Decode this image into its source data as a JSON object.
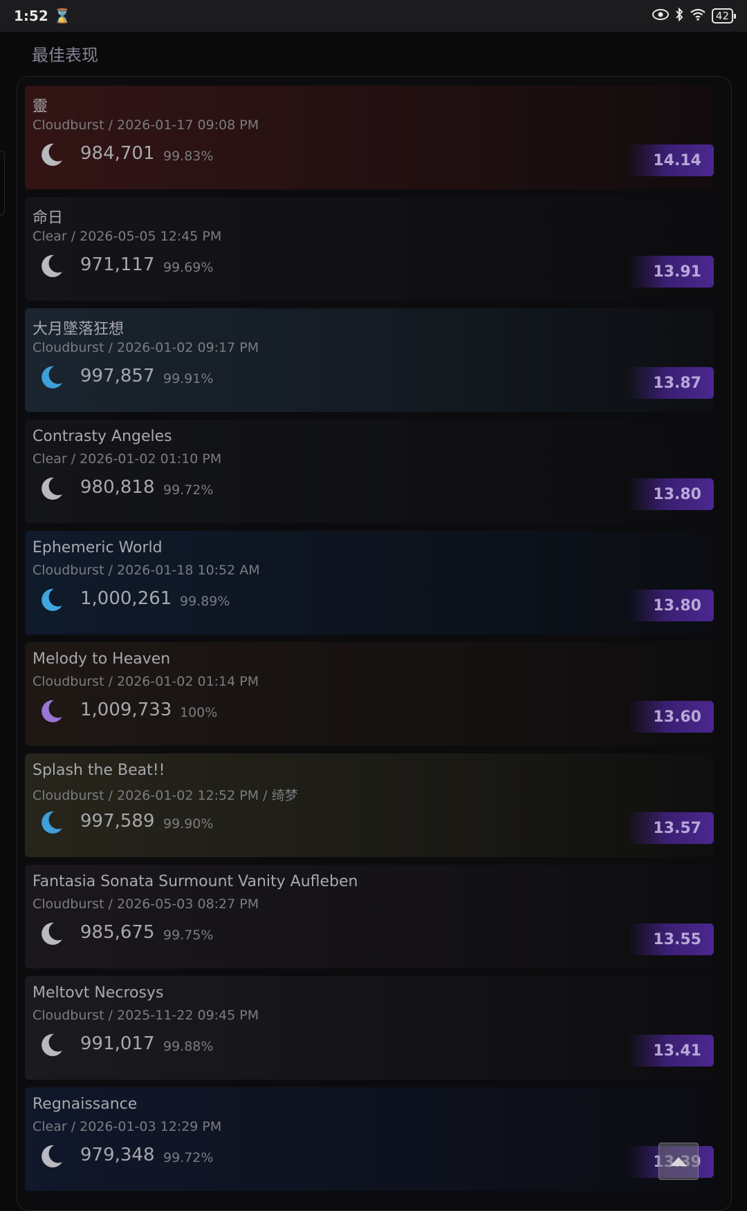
{
  "status_bar": {
    "time": "1:52",
    "battery": "42"
  },
  "section_title": "最佳表现",
  "records": [
    {
      "title": "靈",
      "meta": "Cloudburst / 2026-01-17 09:08 PM",
      "score": "984,701",
      "accuracy": "99.83%",
      "rating": "14.14",
      "moon_color": "#b9b9c0",
      "bg": "#3a1616"
    },
    {
      "title": "命日",
      "meta": "Clear / 2026-05-05 12:45 PM",
      "score": "971,117",
      "accuracy": "99.69%",
      "rating": "13.91",
      "moon_color": "#b9b9c0",
      "bg": "#17171b"
    },
    {
      "title": "大月墜落狂想",
      "meta": "Cloudburst / 2026-01-02 09:17 PM",
      "score": "997,857",
      "accuracy": "99.91%",
      "rating": "13.87",
      "moon_color": "#3f9fd8",
      "bg": "#1d2a36"
    },
    {
      "title": "Contrasty Angeles",
      "meta": "Clear / 2026-01-02 01:10 PM",
      "score": "980,818",
      "accuracy": "99.72%",
      "rating": "13.80",
      "moon_color": "#b9b9c0",
      "bg": "#16171b"
    },
    {
      "title": "Ephemeric World",
      "meta": "Cloudburst / 2026-01-18 10:52 AM",
      "score": "1,000,261",
      "accuracy": "99.89%",
      "rating": "13.80",
      "moon_color": "#3fa6e0",
      "bg": "#101d30"
    },
    {
      "title": "Melody to Heaven",
      "meta": "Cloudburst / 2026-01-02 01:14 PM",
      "score": "1,009,733",
      "accuracy": "100%",
      "rating": "13.60",
      "moon_color": "#9a74d6",
      "bg": "#221a16"
    },
    {
      "title": "Splash the Beat!!",
      "meta": "Cloudburst / 2026-01-02 12:52 PM / 绮梦",
      "score": "997,589",
      "accuracy": "99.90%",
      "rating": "13.57",
      "moon_color": "#3f9fd8",
      "bg": "#2c2a1e"
    },
    {
      "title": "Fantasia Sonata Surmount Vanity Aufleben",
      "meta": "Cloudburst / 2026-05-03 08:27 PM",
      "score": "985,675",
      "accuracy": "99.75%",
      "rating": "13.55",
      "moon_color": "#b9b9c0",
      "bg": "#1e1a1e"
    },
    {
      "title": "Meltovt Necrosys",
      "meta": "Cloudburst / 2025-11-22 09:45 PM",
      "score": "991,017",
      "accuracy": "99.88%",
      "rating": "13.41",
      "moon_color": "#b9b9c0",
      "bg": "#1e1e22"
    },
    {
      "title": "Regnaissance",
      "meta": "Clear / 2026-01-03 12:29 PM",
      "score": "979,348",
      "accuracy": "99.72%",
      "rating": "13.39",
      "moon_color": "#b9b9c0",
      "bg": "#121a30"
    }
  ]
}
